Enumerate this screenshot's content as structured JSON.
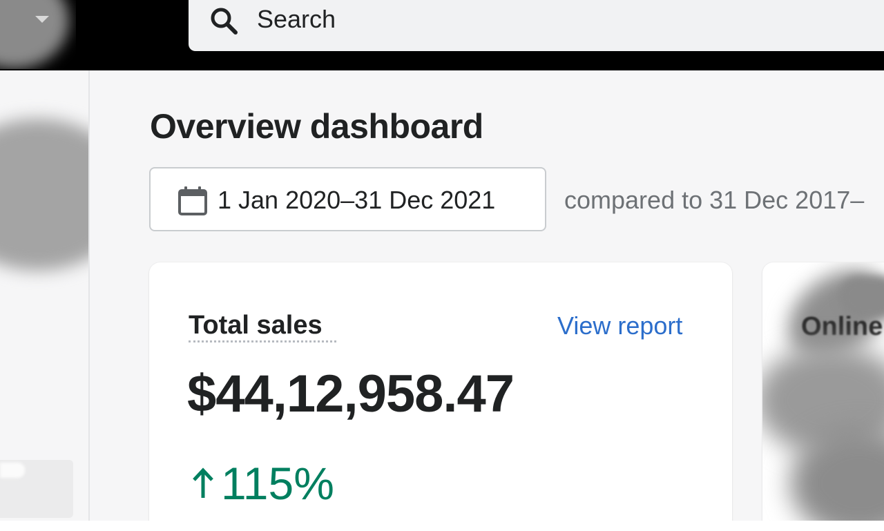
{
  "search": {
    "placeholder": "Search"
  },
  "main": {
    "title": "Overview dashboard",
    "date_range": "1 Jan 2020–31 Dec 2021",
    "comparison": "compared to 31 Dec 2017–"
  },
  "cards": {
    "total_sales": {
      "title": "Total sales",
      "link": "View report",
      "value": "$44,12,958.47",
      "change": "115%"
    },
    "online_store": {
      "title": "Online"
    }
  },
  "colors": {
    "topbar": "#000000",
    "page_bg": "#f6f6f7",
    "link": "#2c6ecb",
    "positive": "#007f5f",
    "text": "#202223",
    "subdued_text": "#6d7175"
  },
  "icons": {
    "search": "search-icon",
    "calendar": "calendar-icon",
    "store_menu": "caret-down-icon",
    "trend": "up-arrow-icon"
  }
}
